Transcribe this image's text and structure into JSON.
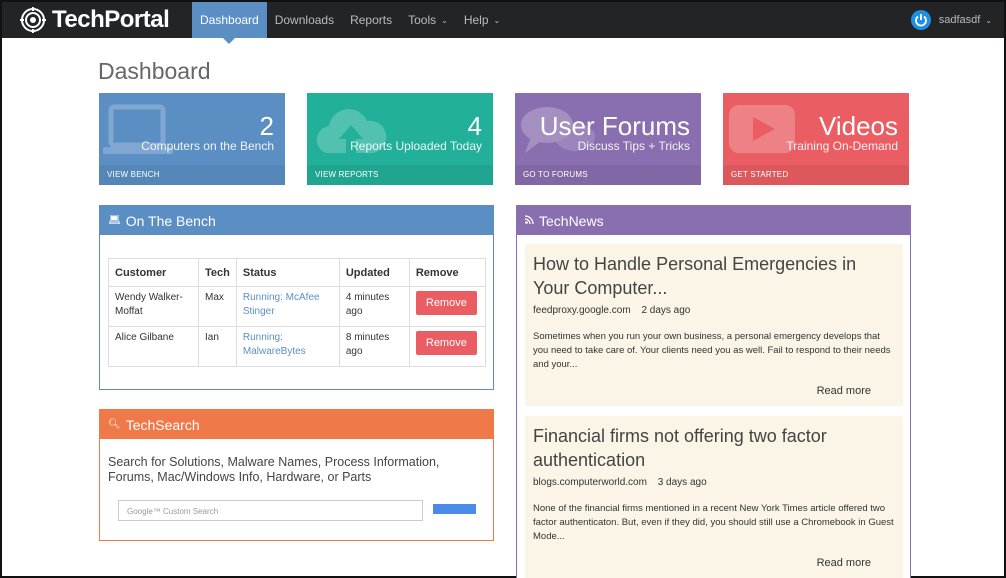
{
  "brand": {
    "name": "TechPortal",
    "icon": "target-icon"
  },
  "nav": {
    "items": [
      {
        "label": "Dashboard",
        "active": true
      },
      {
        "label": "Downloads"
      },
      {
        "label": "Reports"
      },
      {
        "label": "Tools",
        "caret": "⌄"
      },
      {
        "label": "Help",
        "caret": "⌄"
      }
    ],
    "user": {
      "name": "sadfasdf",
      "caret": "⌄",
      "icon": "power-icon"
    }
  },
  "page_title": "Dashboard",
  "tiles": [
    {
      "big": "2",
      "sub": "Computers on the Bench",
      "foot": "VIEW BENCH",
      "icon": "laptop-icon",
      "color": "#5b8fc4"
    },
    {
      "big": "4",
      "sub": "Reports Uploaded Today",
      "foot": "VIEW REPORTS",
      "icon": "cloud-upload-icon",
      "color": "#23b09a"
    },
    {
      "big": "User Forums",
      "sub": "Discuss Tips + Tricks",
      "foot": "GO TO FORUMS",
      "icon": "chat-icon",
      "color": "#8a6fb0"
    },
    {
      "big": "Videos",
      "sub": "Training On-Demand",
      "foot": "GET STARTED",
      "icon": "play-icon",
      "color": "#ea5e63"
    }
  ],
  "bench": {
    "title": "On The Bench",
    "columns": [
      "Customer",
      "Tech",
      "Status",
      "Updated",
      "Remove"
    ],
    "rows": [
      {
        "customer": "Wendy Walker-Moffat",
        "tech": "Max",
        "status": "Running: McAfee Stinger",
        "updated": "4 minutes ago",
        "remove": "Remove"
      },
      {
        "customer": "Alice Gilbane",
        "tech": "Ian",
        "status": "Running: MalwareBytes",
        "updated": "8 minutes ago",
        "remove": "Remove"
      }
    ]
  },
  "techsearch": {
    "title": "TechSearch",
    "description": "Search for Solutions, Malware Names, Process Information, Forums, Mac/Windows Info, Hardware, or Parts",
    "placeholder": "Google™ Custom Search"
  },
  "technews": {
    "title": "TechNews",
    "articles": [
      {
        "title": "How to Handle Personal Emergencies in Your Computer...",
        "source": "feedproxy.google.com",
        "age": "2 days ago",
        "body": "Sometimes when you run your own business, a personal emergency develops that you need to take care of. Your clients need you as well. Fail to respond to their needs and your...",
        "read_more": "Read more"
      },
      {
        "title": "Financial firms not offering two factor authentication",
        "source": "blogs.computerworld.com",
        "age": "3 days ago",
        "body": "None of the financial firms mentioned in a recent New York Times article offered two factor authenticaton. But, even if they did, you should still use a Chromebook in Guest Mode...",
        "read_more": "Read more"
      }
    ]
  }
}
